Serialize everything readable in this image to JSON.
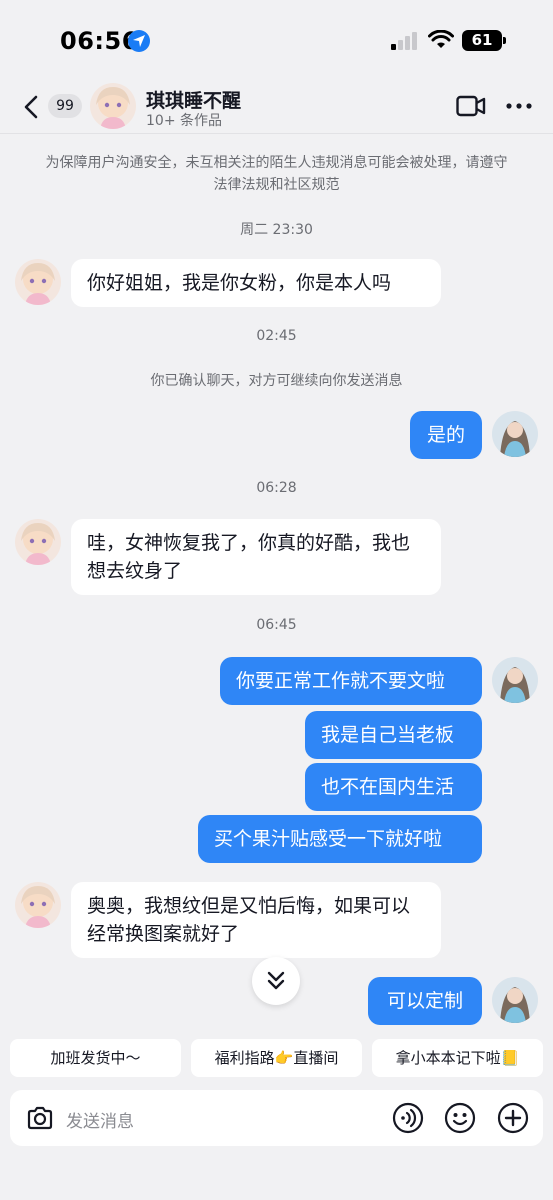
{
  "status_bar": {
    "time": "06:56",
    "battery": "61"
  },
  "header": {
    "unread_count": "99",
    "name": "琪琪睡不醒",
    "subtitle": "10+ 条作品"
  },
  "notice": "为保障用户沟通安全，未互相关注的陌生人违规消息可能会被处理，请遵守法律法规和社区规范",
  "messages": {
    "t1": "周二 23:30",
    "m1": "你好姐姐，我是你女粉，你是本人吗",
    "t2": "02:45",
    "sys1": "你已确认聊天，对方可继续向你发送消息",
    "m2": "是的",
    "t3": "06:28",
    "m3": "哇，女神恢复我了，你真的好酷，我也想去纹身了",
    "t4": "06:45",
    "m4": "你要正常工作就不要文啦",
    "m5": "我是自己当老板",
    "m6": "也不在国内生活",
    "m7": "买个果汁贴感受一下就好啦",
    "m8": "奥奥，我想纹但是又怕后悔，如果可以经常换图案就好了",
    "m9": "可以定制"
  },
  "quick_replies": [
    "加班发货中～",
    "福利指路👉直播间",
    "拿小本本记下啦📒"
  ],
  "input": {
    "placeholder": "发送消息"
  },
  "colors": {
    "bubble_out": "#2f86f6",
    "background": "#f1f1f3",
    "location": "#1a7cf5"
  }
}
